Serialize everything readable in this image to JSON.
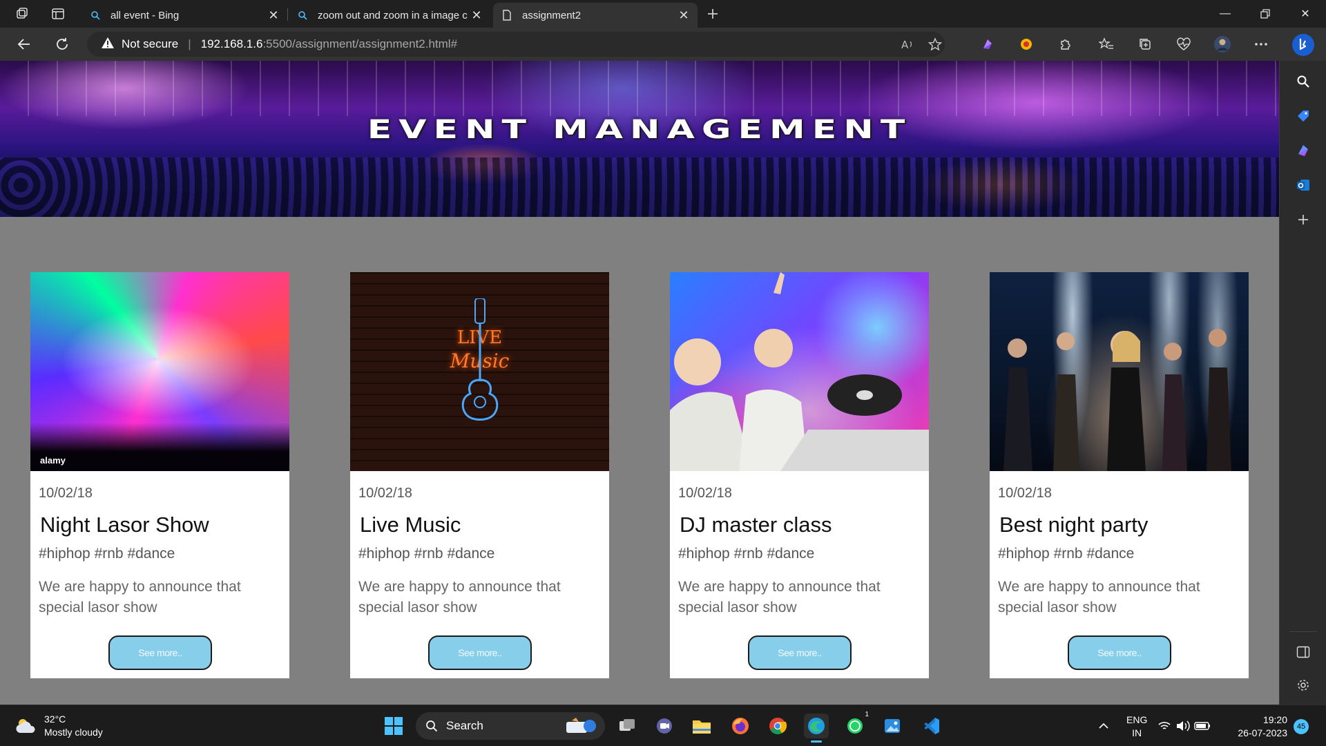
{
  "browser": {
    "tabs": [
      {
        "title": "all event - Bing",
        "icon": "bing-search-icon",
        "active": false
      },
      {
        "title": "zoom out and zoom in a image c",
        "icon": "bing-search-icon",
        "active": false
      },
      {
        "title": "assignment2",
        "icon": "page-icon",
        "active": true
      }
    ],
    "address": {
      "security_label": "Not secure",
      "host": "192.168.1.6",
      "path": ":5500/assignment/assignment2.html#"
    }
  },
  "page": {
    "hero_title": "EVENT MANAGEMENT",
    "cards": [
      {
        "date": "10/02/18",
        "title": "Night Lasor Show",
        "tags": "#hiphop #rnb #dance",
        "description": "We are happy to announce that special lasor show",
        "button": "See more.."
      },
      {
        "date": "10/02/18",
        "title": "Live Music",
        "tags": "#hiphop #rnb #dance",
        "description": "We are happy to announce that special lasor show",
        "button": "See more.."
      },
      {
        "date": "10/02/18",
        "title": "DJ master class",
        "tags": "#hiphop #rnb #dance",
        "description": "We are happy to announce that special lasor show",
        "button": "See more.."
      },
      {
        "date": "10/02/18",
        "title": "Best night party",
        "tags": "#hiphop #rnb #dance",
        "description": "We are happy to announce that special lasor show",
        "button": "See more.."
      }
    ],
    "image_marks": {
      "watermark": "alamy",
      "neon_line1": "LIVE",
      "neon_line2": "Music"
    },
    "colors": {
      "page_bg": "#808080",
      "card_bg": "#ffffff",
      "button_bg": "#87ceeb"
    }
  },
  "taskbar": {
    "weather_temp": "32°C",
    "weather_desc": "Mostly cloudy",
    "search_placeholder": "Search",
    "lang_line1": "ENG",
    "lang_line2": "IN",
    "time": "19:20",
    "date": "26-07-2023",
    "notification_count": "45",
    "whatsapp_badge": "1"
  }
}
